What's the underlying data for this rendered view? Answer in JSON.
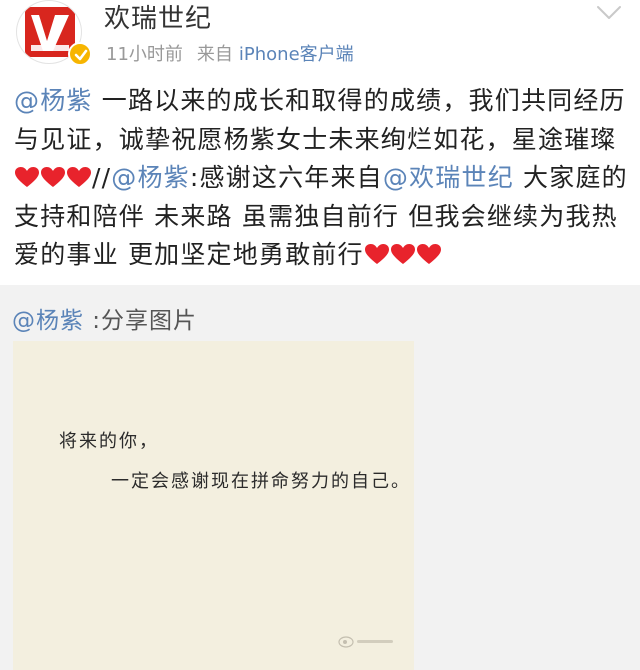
{
  "colors": {
    "link": "#5b84b8",
    "meta": "#999999",
    "verified": "#f7b500",
    "heart": "#e8232c",
    "repost_bg": "#f2f2f2"
  },
  "header": {
    "avatar_icon": "huanrui-logo-icon",
    "verified_icon": "verified-badge-icon",
    "user_name": "欢瑞世纪",
    "time_ago": "11小时前",
    "source_prefix": "来自",
    "source_device": "iPhone客户端",
    "menu_icon": "chevron-down-icon"
  },
  "post": {
    "m1": "@杨紫",
    "t1": " 一路以来的成长和取得的成绩，我们共同经历与见证，诚挚祝愿杨紫女士未来绚烂如花，星途璀璨",
    "sep": "//",
    "m2": "@杨紫",
    "t2": ":感谢这六年来自",
    "m3": "@欢瑞世纪",
    "t3": " 大家庭的支持和陪伴 未来路 虽需独自前行 但我会继续为我热爱的事业 更加坚定地勇敢前行",
    "heart_icon": "red-heart-icon"
  },
  "repost": {
    "mention": "@杨紫",
    "text": " :分享图片",
    "image": {
      "line1": "将来的你，",
      "line2": "一定会感谢现在拼命努力的自己。"
    }
  }
}
